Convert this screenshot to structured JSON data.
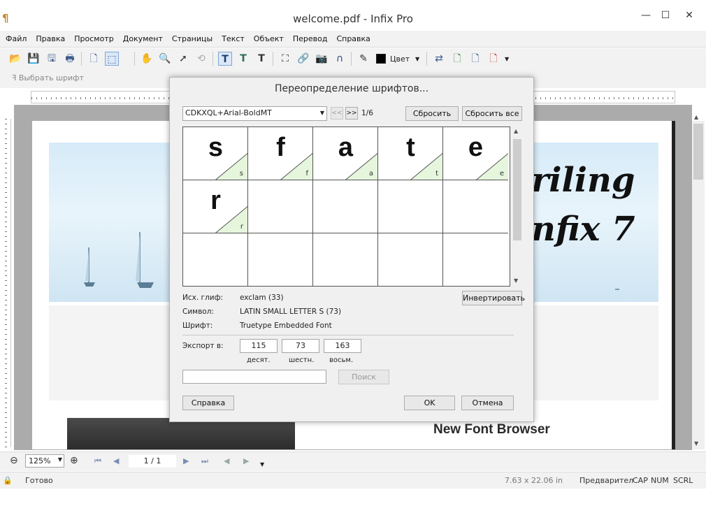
{
  "window": {
    "title": "welcome.pdf - Infix Pro",
    "minimize": "—",
    "maximize": "☐",
    "close": "✕"
  },
  "menu": [
    "Файл",
    "Правка",
    "Просмотр",
    "Документ",
    "Страницы",
    "Текст",
    "Объект",
    "Перевод",
    "Справка"
  ],
  "toolbar": {
    "color_label": "Цвет",
    "font_placeholder": "Выбрать шрифт"
  },
  "document": {
    "cover_line1": "riling",
    "cover_line2": "nfix 7",
    "heading": "New Font Browser"
  },
  "nav": {
    "zoom": "125%",
    "page": "1 / 1"
  },
  "status": {
    "text": "Готово",
    "dimensions": "7.63 x 22.06 in",
    "mode": "Предварител",
    "cap": "CAP",
    "num": "NUM",
    "scrl": "SCRL"
  },
  "dialog": {
    "title": "Переопределение шрифтов...",
    "font_combo": "CDKXQL+Arial-BoldMT",
    "prev": "<<",
    "next": ">>",
    "counter": "1/6",
    "reset": "Сбросить",
    "reset_all": "Сбросить все",
    "glyphs": [
      {
        "char": "s",
        "mapped": "s"
      },
      {
        "char": "f",
        "mapped": "f"
      },
      {
        "char": "a",
        "mapped": "a"
      },
      {
        "char": "t",
        "mapped": "t"
      },
      {
        "char": "e",
        "mapped": "e"
      },
      {
        "char": "r",
        "mapped": "r"
      }
    ],
    "src_glyph_label": "Исх. глиф:",
    "src_glyph_value": "exclam (33)",
    "invert": "Инвертировать",
    "symbol_label": "Символ:",
    "symbol_value": "LATIN SMALL LETTER S (73)",
    "font_label": "Шрифт:",
    "font_value": "Truetype Embedded Font",
    "export_label": "Экспорт в:",
    "dec": "115",
    "hex": "73",
    "oct": "163",
    "dec_label": "десят.",
    "hex_label": "шестн.",
    "oct_label": "восьм.",
    "search_value": "",
    "search": "Поиск",
    "help": "Справка",
    "ok": "OK",
    "cancel": "Отмена"
  }
}
